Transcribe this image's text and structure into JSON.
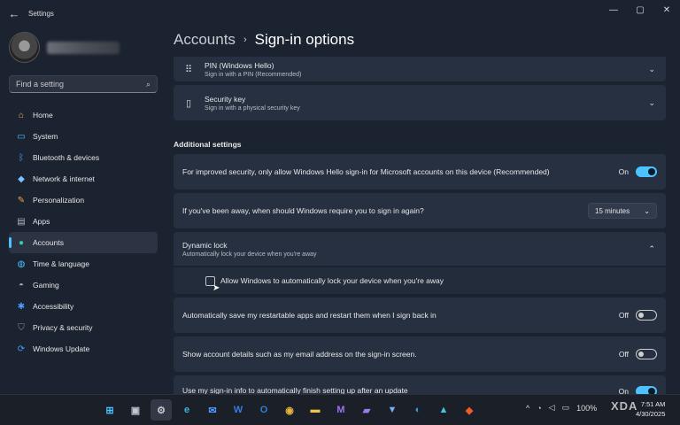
{
  "window": {
    "title": "Settings",
    "back_glyph": "←",
    "controls": {
      "minimize": "—",
      "maximize": "▢",
      "close": "✕"
    }
  },
  "sidebar": {
    "search": {
      "placeholder": "Find a setting",
      "icon": "search-icon"
    },
    "items": [
      {
        "label": "Home",
        "icon": "home-icon",
        "color": "#f0b44c"
      },
      {
        "label": "System",
        "icon": "system-icon",
        "color": "#4cc2ff"
      },
      {
        "label": "Bluetooth & devices",
        "icon": "bluetooth-icon",
        "color": "#4c9bff"
      },
      {
        "label": "Network & internet",
        "icon": "wifi-icon",
        "color": "#7cc4ff"
      },
      {
        "label": "Personalization",
        "icon": "brush-icon",
        "color": "#f0a04c"
      },
      {
        "label": "Apps",
        "icon": "apps-icon",
        "color": "#b0b6c0"
      },
      {
        "label": "Accounts",
        "icon": "person-icon",
        "color": "#3cc9a0",
        "active": true
      },
      {
        "label": "Time & language",
        "icon": "globe-icon",
        "color": "#4cc2ff"
      },
      {
        "label": "Gaming",
        "icon": "gamepad-icon",
        "color": "#a0a6b0"
      },
      {
        "label": "Accessibility",
        "icon": "accessibility-icon",
        "color": "#4c9bff"
      },
      {
        "label": "Privacy & security",
        "icon": "shield-icon",
        "color": "#8a92a0"
      },
      {
        "label": "Windows Update",
        "icon": "update-icon",
        "color": "#4c9bff"
      }
    ]
  },
  "main": {
    "breadcrumb": {
      "parent": "Accounts",
      "separator": "›",
      "current": "Sign-in options"
    },
    "pin": {
      "title": "PIN (Windows Hello)",
      "subtitle": "Sign in with a PIN (Recommended)"
    },
    "security_key": {
      "title": "Security key",
      "subtitle": "Sign in with a physical security key"
    },
    "additional_title": "Additional settings",
    "hello_only": {
      "label": "For improved security, only allow Windows Hello sign-in for Microsoft accounts on this device (Recommended)",
      "state": "On"
    },
    "require_signin": {
      "label": "If you've been away, when should Windows require you to sign in again?",
      "value": "15 minutes"
    },
    "dynamic_lock": {
      "title": "Dynamic lock",
      "subtitle": "Automatically lock your device when you're away",
      "checkbox_label": "Allow Windows to automatically lock your device when you're away"
    },
    "restart_apps": {
      "label": "Automatically save my restartable apps and restart them when I sign back in",
      "state": "Off"
    },
    "account_details": {
      "label": "Show account details such as my email address on the sign-in screen.",
      "state": "Off"
    },
    "signin_info": {
      "label": "Use my sign-in info to automatically finish setting up after an update",
      "state": "On"
    }
  },
  "taskbar": {
    "apps": [
      {
        "name": "start-icon",
        "glyph": "⊞",
        "color": "#4cc2ff"
      },
      {
        "name": "task-view-icon",
        "glyph": "▣",
        "color": "#c0c6d0"
      },
      {
        "name": "settings-app-icon",
        "glyph": "⚙",
        "color": "#c0c6d0",
        "active": true
      },
      {
        "name": "edge-icon",
        "glyph": "e",
        "color": "#3fb4e0"
      },
      {
        "name": "mail-icon",
        "glyph": "✉",
        "color": "#4c9bff"
      },
      {
        "name": "word-icon",
        "glyph": "W",
        "color": "#3a7be0"
      },
      {
        "name": "outlook-icon",
        "glyph": "O",
        "color": "#2f7fd6"
      },
      {
        "name": "chrome-icon",
        "glyph": "◉",
        "color": "#e8b43c"
      },
      {
        "name": "file-explorer-icon",
        "glyph": "▬",
        "color": "#f0c44c"
      },
      {
        "name": "clipchamp-icon",
        "glyph": "M",
        "color": "#a070f0"
      },
      {
        "name": "folder-icon",
        "glyph": "▰",
        "color": "#9a7cf0"
      },
      {
        "name": "vpn-icon",
        "glyph": "▼",
        "color": "#7ab0f0"
      },
      {
        "name": "browser-icon",
        "glyph": "◐",
        "color": "#3a9be0"
      },
      {
        "name": "photos-icon",
        "glyph": "▲",
        "color": "#4cc2e0"
      },
      {
        "name": "brave-icon",
        "glyph": "◆",
        "color": "#f05a2c"
      }
    ],
    "tray": {
      "chevron": "^",
      "network_icon": "wifi-icon",
      "volume_icon": "volume-icon",
      "battery": "100%"
    },
    "clock": {
      "time": "7:51 AM",
      "date": "4/30/2025"
    }
  },
  "watermark": "XDA"
}
